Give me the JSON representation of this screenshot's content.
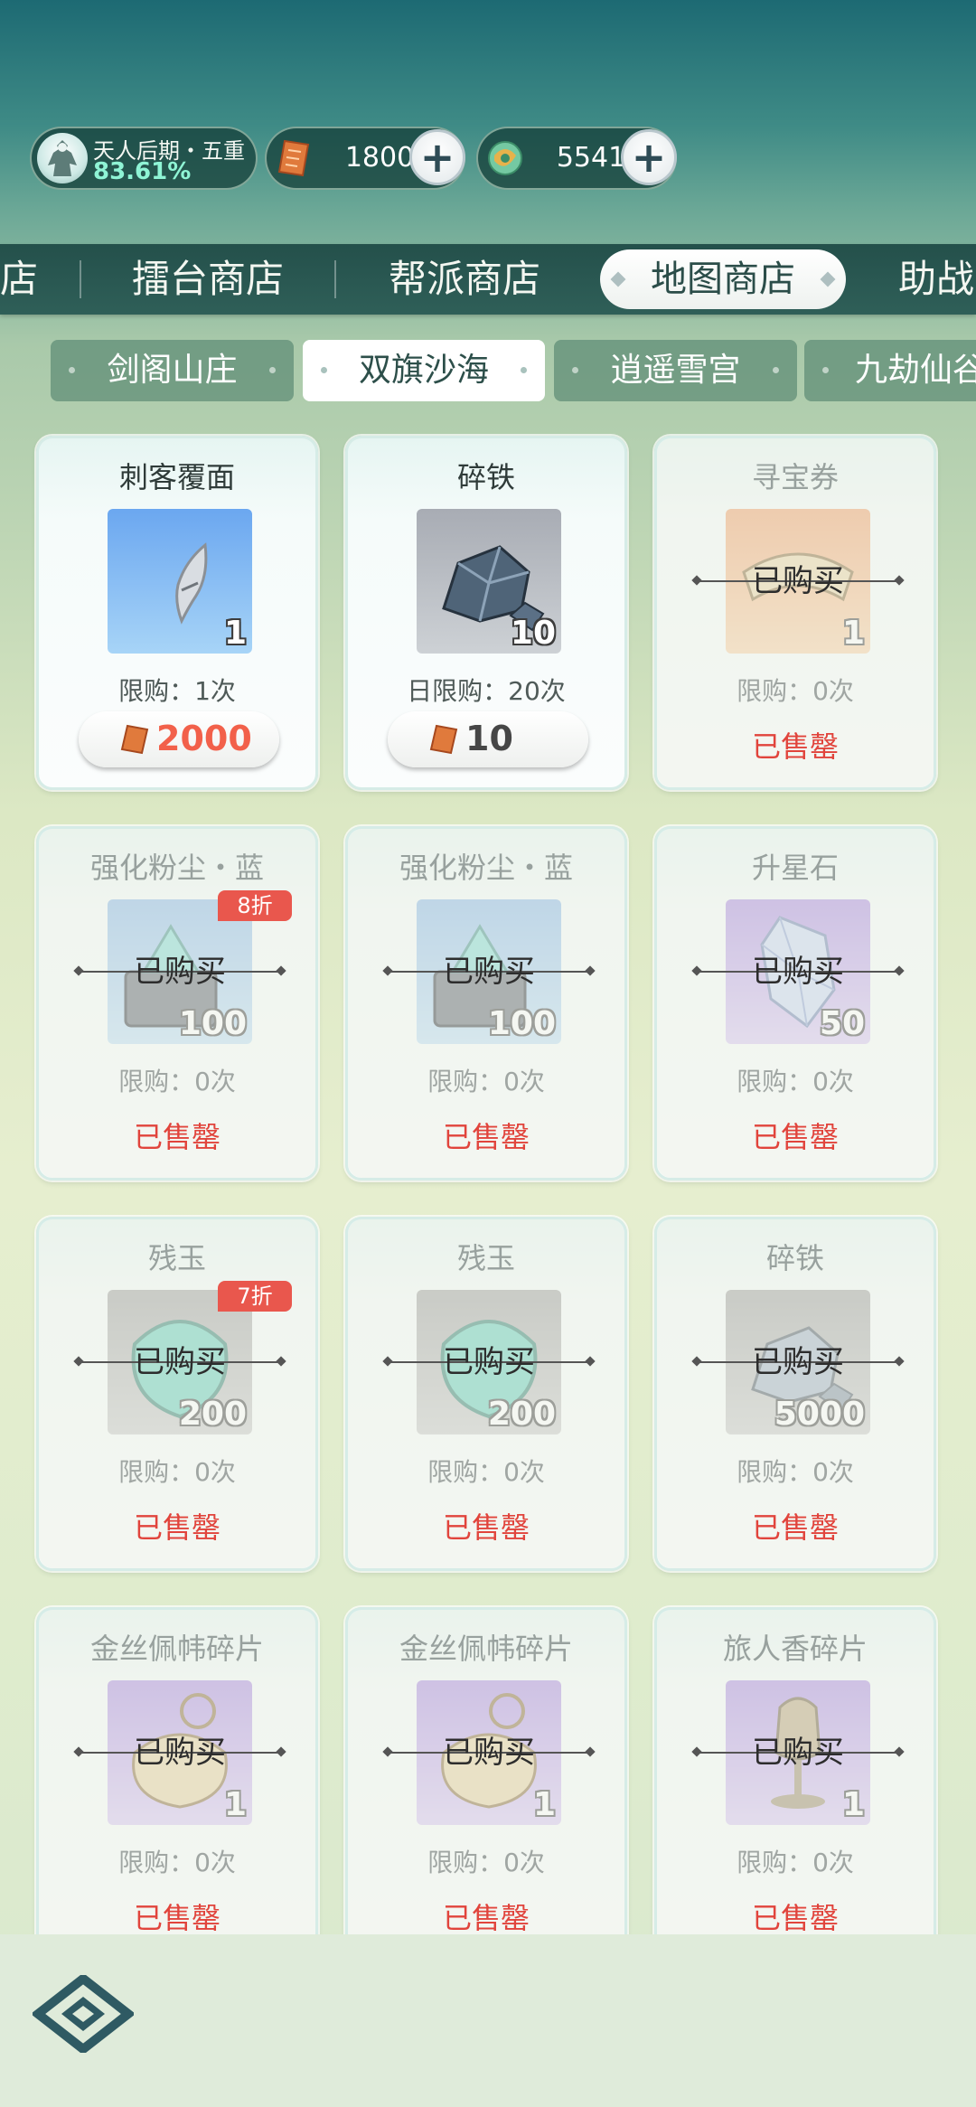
{
  "status": {
    "realm_name": "天人后期・五重",
    "realm_progress": "83.61%",
    "currency1": {
      "icon": "ticket-icon",
      "value": "1800"
    },
    "currency2": {
      "icon": "jade-coin-icon",
      "value": "5541"
    }
  },
  "main_tabs": [
    {
      "label": "店",
      "active": false
    },
    {
      "label": "擂台商店",
      "active": false
    },
    {
      "label": "帮派商店",
      "active": false
    },
    {
      "label": "地图商店",
      "active": true
    },
    {
      "label": "助战",
      "active": false
    }
  ],
  "sub_tabs": [
    {
      "label": "剑阁山庄",
      "active": false
    },
    {
      "label": "双旗沙海",
      "active": true
    },
    {
      "label": "逍遥雪宫",
      "active": false
    },
    {
      "label": "九劫仙谷",
      "active": false
    }
  ],
  "labels": {
    "bought": "已购买",
    "sold_out": "已售罄"
  },
  "items": [
    {
      "name": "刺客覆面",
      "qty": "1",
      "limit": "限购：1次",
      "price": "2000",
      "sold_out": false,
      "discount": ""
    },
    {
      "name": "碎铁",
      "qty": "10",
      "limit": "日限购：20次",
      "price": "10",
      "sold_out": false,
      "discount": ""
    },
    {
      "name": "寻宝券",
      "qty": "1",
      "limit": "限购：0次",
      "price": "",
      "sold_out": true,
      "discount": ""
    },
    {
      "name": "强化粉尘・蓝",
      "qty": "100",
      "limit": "限购：0次",
      "price": "",
      "sold_out": true,
      "discount": "8折"
    },
    {
      "name": "强化粉尘・蓝",
      "qty": "100",
      "limit": "限购：0次",
      "price": "",
      "sold_out": true,
      "discount": ""
    },
    {
      "name": "升星石",
      "qty": "50",
      "limit": "限购：0次",
      "price": "",
      "sold_out": true,
      "discount": ""
    },
    {
      "name": "残玉",
      "qty": "200",
      "limit": "限购：0次",
      "price": "",
      "sold_out": true,
      "discount": "7折"
    },
    {
      "name": "残玉",
      "qty": "200",
      "limit": "限购：0次",
      "price": "",
      "sold_out": true,
      "discount": ""
    },
    {
      "name": "碎铁",
      "qty": "5000",
      "limit": "限购：0次",
      "price": "",
      "sold_out": true,
      "discount": ""
    },
    {
      "name": "金丝佩帏碎片",
      "qty": "1",
      "limit": "限购：0次",
      "price": "",
      "sold_out": true,
      "discount": ""
    },
    {
      "name": "金丝佩帏碎片",
      "qty": "1",
      "limit": "限购：0次",
      "price": "",
      "sold_out": true,
      "discount": ""
    },
    {
      "name": "旅人香碎片",
      "qty": "1",
      "limit": "限购：0次",
      "price": "",
      "sold_out": true,
      "discount": ""
    }
  ],
  "bottom": {
    "home_icon": "home-icon"
  }
}
